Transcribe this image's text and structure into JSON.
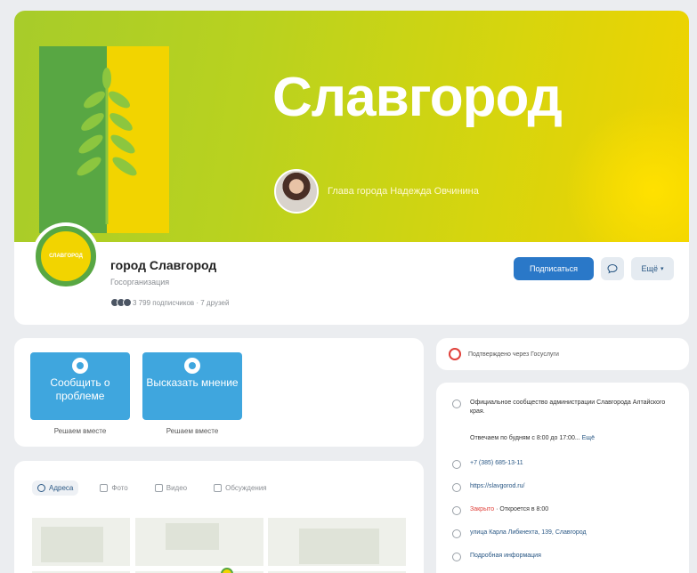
{
  "banner": {
    "title": "Славгород",
    "head_caption": "Глава города Надежда Овчинина"
  },
  "profile": {
    "avatar_text": "СЛАВГОРОД",
    "name": "город Славгород",
    "category": "Госорганизация",
    "stats": "3 799 подписчиков · 7 друзей",
    "subscribe_label": "Подписаться",
    "more_label": "Ещё"
  },
  "actions": [
    {
      "label": "Сообщить о проблеме",
      "caption": "Решаем вместе"
    },
    {
      "label": "Высказать мнение",
      "caption": "Решаем вместе"
    }
  ],
  "map_tabs": [
    {
      "label": "Адреса",
      "icon": "map-pin-icon",
      "active": true
    },
    {
      "label": "Фото",
      "icon": "photo-icon",
      "active": false
    },
    {
      "label": "Видео",
      "icon": "video-icon",
      "active": false
    },
    {
      "label": "Обсуждения",
      "icon": "chat-icon",
      "active": false
    }
  ],
  "verified_text": "Подтверждено через Госуслуги",
  "info": {
    "description": "Официальное сообщество администрации Славгорода Алтайского края.",
    "reply_time": "Отвечаем по будням с 8:00 до 17:00...",
    "reply_more": "Ещё",
    "phone": "+7 (385) 685-13-11",
    "website": "https://slavgorod.ru/",
    "status_closed": "Закрыто",
    "status_opens": "· Откроется в 8:00",
    "address": "улица Карла Либкнехта, 139, Славгород",
    "details": "Подробная информация"
  },
  "colors": {
    "accent_blue": "#2a78c8",
    "action_blue": "#3fa6de",
    "brand_green": "#58a743",
    "brand_yellow": "#f2d400",
    "closed_red": "#e0403a"
  }
}
